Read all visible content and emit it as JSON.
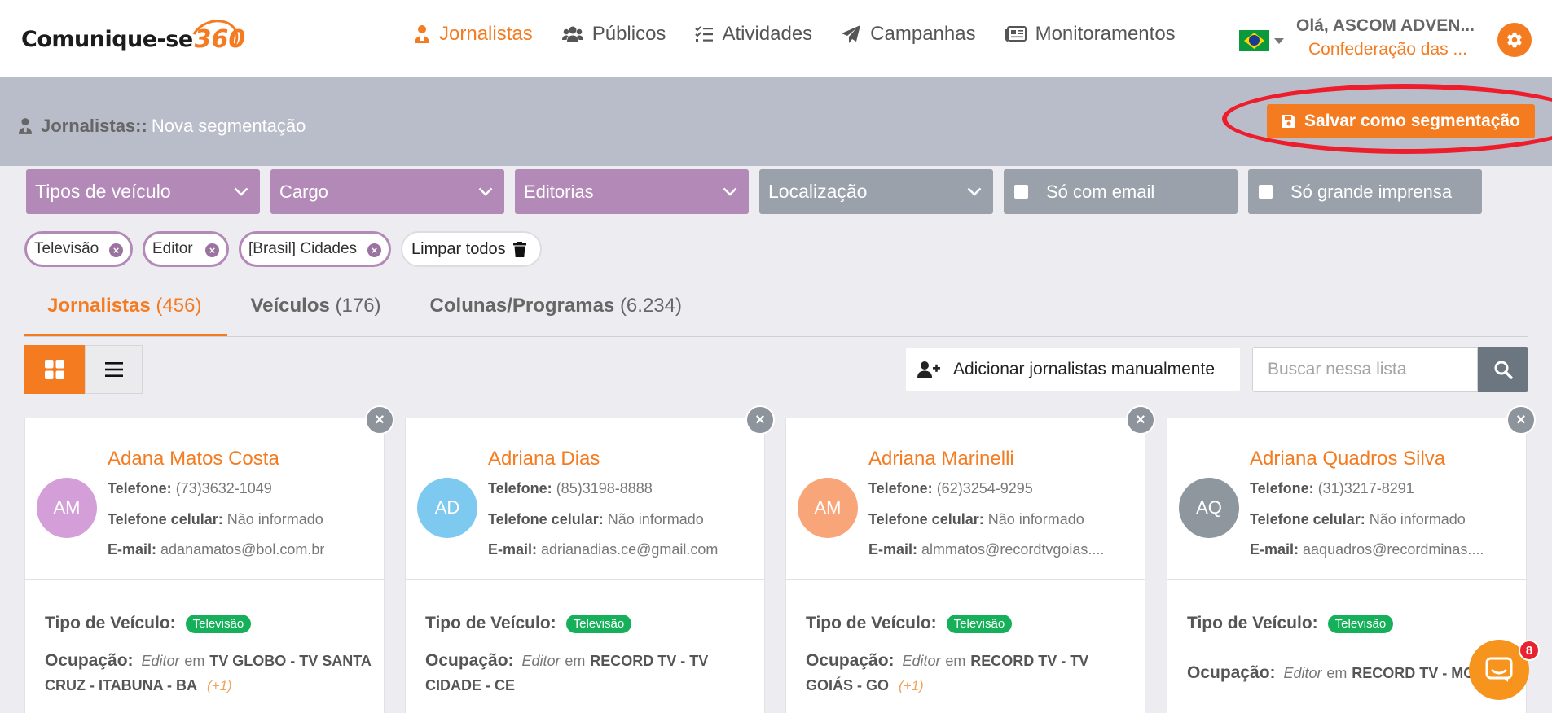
{
  "logo": {
    "text": "Comunique-se",
    "number": "360"
  },
  "nav": {
    "items": [
      {
        "label": "Jornalistas",
        "icon": "journalist-icon",
        "active": true
      },
      {
        "label": "Públicos",
        "icon": "users-icon",
        "active": false
      },
      {
        "label": "Atividades",
        "icon": "checklist-icon",
        "active": false
      },
      {
        "label": "Campanhas",
        "icon": "paper-plane-icon",
        "active": false
      },
      {
        "label": "Monitoramentos",
        "icon": "newspaper-icon",
        "active": false
      }
    ]
  },
  "user": {
    "greeting": "Olá, ASCOM ADVEN...",
    "organization": "Confederação das ..."
  },
  "header": {
    "section": "Jornalistas::",
    "page": "Nova segmentação",
    "save_label": "Salvar como segmentação"
  },
  "filters": {
    "vehicle_type": "Tipos de veículo",
    "role": "Cargo",
    "editorials": "Editorias",
    "location": "Localização",
    "only_email": "Só com email",
    "only_big_press": "Só grande imprensa"
  },
  "chips": {
    "items": [
      "Televisão",
      "Editor",
      "[Brasil] Cidades"
    ],
    "clear_all": "Limpar todos"
  },
  "tabs": [
    {
      "label": "Jornalistas",
      "count": "(456)",
      "active": true
    },
    {
      "label": "Veículos",
      "count": "(176)",
      "active": false
    },
    {
      "label": "Colunas/Programas",
      "count": "(6.234)",
      "active": false
    }
  ],
  "toolbar": {
    "add_label": "Adicionar jornalistas manualmente",
    "search_placeholder": "Buscar nessa lista"
  },
  "labels": {
    "phone": "Telefone:",
    "mobile": "Telefone celular:",
    "email": "E-mail:",
    "vehicle_type": "Tipo de Veículo:",
    "occupation": "Ocupação:",
    "at": "em"
  },
  "cards": [
    {
      "initials": "AM",
      "avatar_color": "#d49fd8",
      "name": "Adana Matos Costa",
      "phone": "(73)3632-1049",
      "mobile": "Não informado",
      "email": "adanamatos@bol.com.br",
      "vehicle_badge": "Televisão",
      "role": "Editor",
      "org": "TV GLOBO - TV SANTA CRUZ - ITABUNA - BA",
      "more": "(+1)"
    },
    {
      "initials": "AD",
      "avatar_color": "#7ec9ef",
      "name": "Adriana Dias",
      "phone": "(85)3198-8888",
      "mobile": "Não informado",
      "email": "adrianadias.ce@gmail.com",
      "vehicle_badge": "Televisão",
      "role": "Editor",
      "org": "RECORD TV - TV CIDADE - CE",
      "more": ""
    },
    {
      "initials": "AM",
      "avatar_color": "#f8a57a",
      "name": "Adriana Marinelli",
      "phone": "(62)3254-9295",
      "mobile": "Não informado",
      "email": "almmatos@recordtvgoias....",
      "vehicle_badge": "Televisão",
      "role": "Editor",
      "org": "RECORD TV - TV GOIÁS - GO",
      "more": "(+1)"
    },
    {
      "initials": "AQ",
      "avatar_color": "#8e969e",
      "name": "Adriana Quadros Silva",
      "phone": "(31)3217-8291",
      "mobile": "Não informado",
      "email": "aaquadros@recordminas....",
      "vehicle_badge": "Televisão",
      "role": "Editor",
      "org": "RECORD TV - MG",
      "more": ""
    }
  ],
  "chat": {
    "unread": "8"
  },
  "colors": {
    "accent": "#f47b20",
    "filter_purple": "#b38ab7",
    "filter_grey": "#9aa1ab",
    "badge_green": "#16b05a"
  }
}
